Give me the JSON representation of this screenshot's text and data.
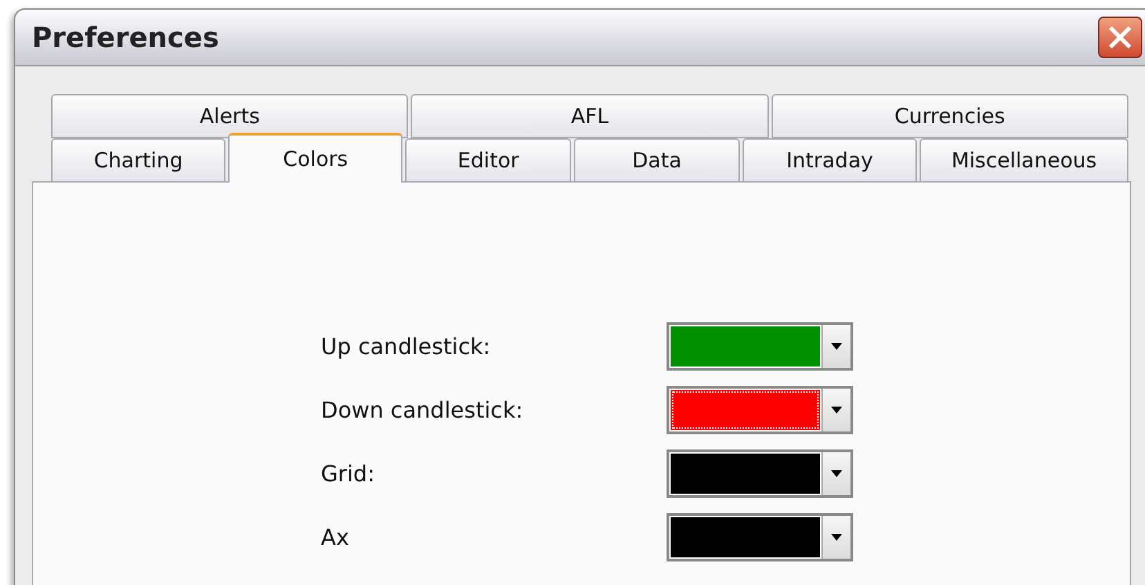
{
  "window": {
    "title": "Preferences"
  },
  "tab_rows": [
    [
      {
        "label": "Alerts",
        "selected": false
      },
      {
        "label": "AFL",
        "selected": false
      },
      {
        "label": "Currencies",
        "selected": false
      }
    ],
    [
      {
        "label": "Charting",
        "selected": false
      },
      {
        "label": "Colors",
        "selected": true
      },
      {
        "label": "Editor",
        "selected": false
      },
      {
        "label": "Data",
        "selected": false
      },
      {
        "label": "Intraday",
        "selected": false
      },
      {
        "label": "Miscellaneous",
        "selected": false
      }
    ]
  ],
  "color_settings": [
    {
      "label": "Up candlestick:",
      "color": "#009000",
      "focused": false
    },
    {
      "label": "Down candlestick:",
      "color": "#ff0000",
      "focused": true
    },
    {
      "label": "Grid:",
      "color": "#000000",
      "focused": false
    },
    {
      "label": "Ax",
      "color": "#000000",
      "focused": false
    }
  ]
}
